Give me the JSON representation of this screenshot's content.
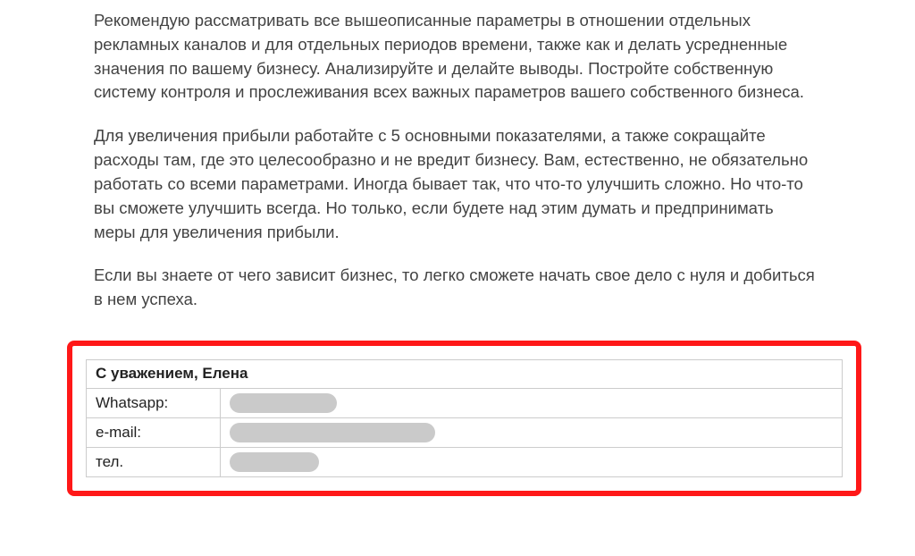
{
  "paragraphs": {
    "p1": "Рекомендую рассматривать все вышеописанные параметры в отношении отдельных рекламных каналов и для отдельных периодов времени, также как и делать усредненные значения по вашему бизнесу. Анализируйте и делайте выводы. Постройте собственную систему контроля и прослеживания всех важных параметров вашего собственного бизнеса.",
    "p2": "Для увеличения прибыли работайте с 5 основными показателями, а также сокращайте расходы там, где это целесообразно и не вредит бизнесу. Вам, естественно, не обязательно работать со всеми параметрами. Иногда бывает так, что что-то улучшить сложно. Но что-то вы сможете улучшить всегда. Но только, если будете над этим думать и предпринимать меры для увеличения прибыли.",
    "p3": "Если вы знаете от чего зависит бизнес, то легко сможете начать свое дело с нуля и добиться в нем успеха."
  },
  "contact": {
    "title": "С уважением, Елена",
    "rows": [
      {
        "label": "Whatsapp:"
      },
      {
        "label": "e-mail:"
      },
      {
        "label": "тел."
      }
    ]
  }
}
